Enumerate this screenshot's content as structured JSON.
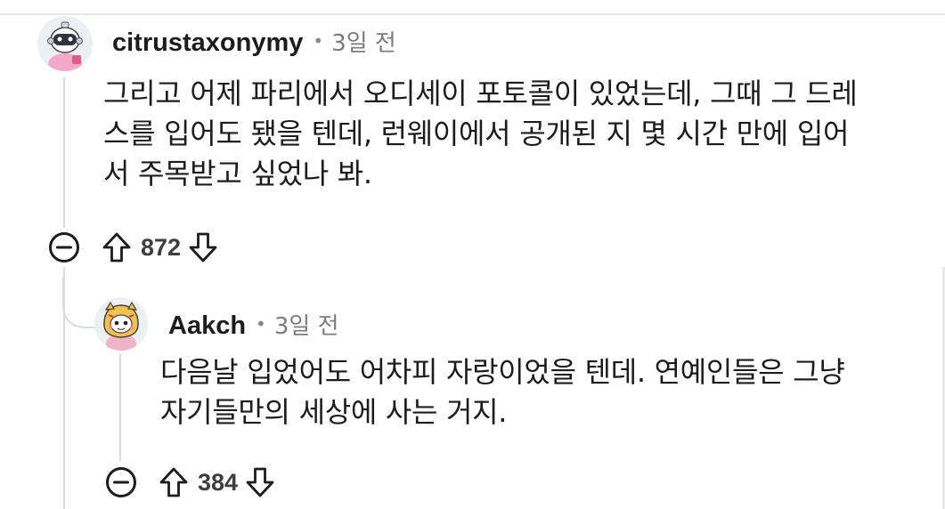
{
  "comments": [
    {
      "username": "citrustaxonymy",
      "separator": "•",
      "time": "3일 전",
      "lines": [
        "그리고 어제 파리에서 오디세이 포토콜이 있었는데, 그때 그 드레",
        "스를 입어도 됐을 텐데, 런웨이에서 공개된 지 몇 시간 만에 입어",
        "서 주목받고 싶었나 봐."
      ],
      "score": "872",
      "avatar_icon": "robot-snoo-avatar-icon"
    },
    {
      "username": "Aakch",
      "separator": "•",
      "time": "3일 전",
      "lines": [
        "다음날 입었어도 어차피 자랑이었을 텐데. 연예인들은 그냥",
        "자기들만의 세상에 사는 거지."
      ],
      "score": "384",
      "avatar_icon": "tiger-hood-snoo-avatar-icon"
    }
  ],
  "icons": {
    "collapse": "collapse-minus-icon",
    "upvote": "upvote-arrow-icon",
    "downvote": "downvote-arrow-icon"
  },
  "colors": {
    "text": "#1c1c1c",
    "meta": "#7c7c7c",
    "thread_line": "#dcdcdc"
  }
}
